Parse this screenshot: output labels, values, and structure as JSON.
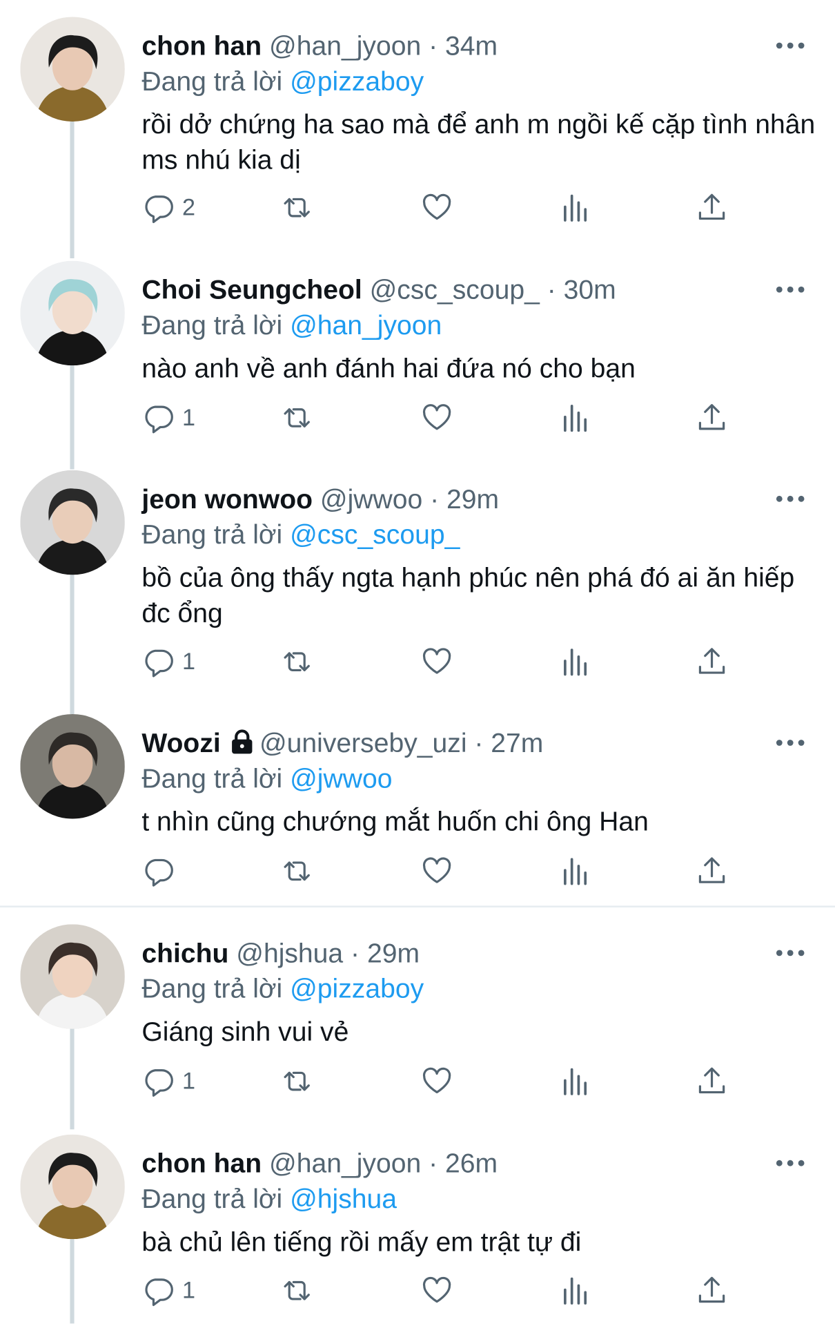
{
  "reply_prefix": "Đang trả lời",
  "tweets": [
    {
      "name": "chon han",
      "handle": "@han_jyoon",
      "time": "34m",
      "reply_to": "@pizzaboy",
      "text": "rồi dở chứng ha sao mà để anh m ngồi kế cặp tình nhân ms nhú kia dị",
      "replies": "2"
    },
    {
      "name": "Choi Seungcheol",
      "handle": "@csc_scoup_",
      "time": "30m",
      "reply_to": "@han_jyoon",
      "text": "nào anh về anh đánh hai đứa nó cho bạn",
      "replies": "1"
    },
    {
      "name": "jeon wonwoo",
      "handle": "@jwwoo",
      "time": "29m",
      "reply_to": "@csc_scoup_",
      "text": "bồ của ông thấy ngta hạnh phúc nên phá đó ai ăn hiếp đc ổng",
      "replies": "1"
    },
    {
      "name": "Woozi",
      "handle": "@universeby_uzi",
      "time": "27m",
      "reply_to": "@jwwoo",
      "text": "t nhìn cũng chướng mắt huốn chi ông Han",
      "replies": ""
    },
    {
      "name": "chichu",
      "handle": "@hjshua",
      "time": "29m",
      "reply_to": "@pizzaboy",
      "text": "Giáng sinh vui vẻ",
      "replies": "1"
    },
    {
      "name": "chon han",
      "handle": "@han_jyoon",
      "time": "26m",
      "reply_to": "@hjshua",
      "text": "bà chủ lên tiếng rồi mấy em trật tự đi",
      "replies": "1"
    }
  ],
  "colors": {
    "accent": "#1d9bf0",
    "text": "#0f1419",
    "muted": "#536471",
    "line": "#cfd9de"
  },
  "icons": [
    "reply-icon",
    "retweet-icon",
    "like-icon",
    "views-icon",
    "share-icon",
    "more-icon",
    "lock-icon"
  ]
}
